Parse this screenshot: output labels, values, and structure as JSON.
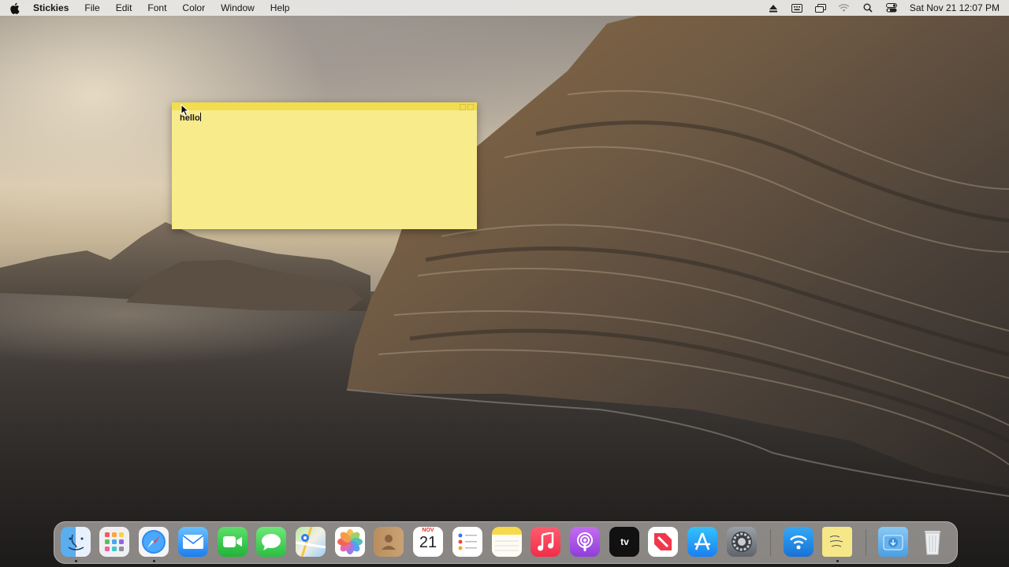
{
  "menubar": {
    "app_name": "Stickies",
    "menus": [
      "File",
      "Edit",
      "Font",
      "Color",
      "Window",
      "Help"
    ],
    "clock": "Sat Nov 21  12:07 PM"
  },
  "sticky": {
    "text": "hello",
    "color": "#f8eb8c",
    "titlebar_color": "#f1dd4e"
  },
  "dock": {
    "calendar_month": "NOV",
    "calendar_day": "21",
    "tv_label": "tv",
    "apps": [
      "Finder",
      "Launchpad",
      "Safari",
      "Mail",
      "FaceTime",
      "Messages",
      "Maps",
      "Photos",
      "Contacts",
      "Calendar",
      "Reminders",
      "Notes",
      "Music",
      "Podcasts",
      "TV",
      "News",
      "App Store",
      "System Preferences",
      "Wi-Fi Explorer",
      "Stickies Note",
      "Downloads",
      "Trash"
    ],
    "running": [
      "Finder",
      "Safari",
      "Stickies Note"
    ]
  }
}
